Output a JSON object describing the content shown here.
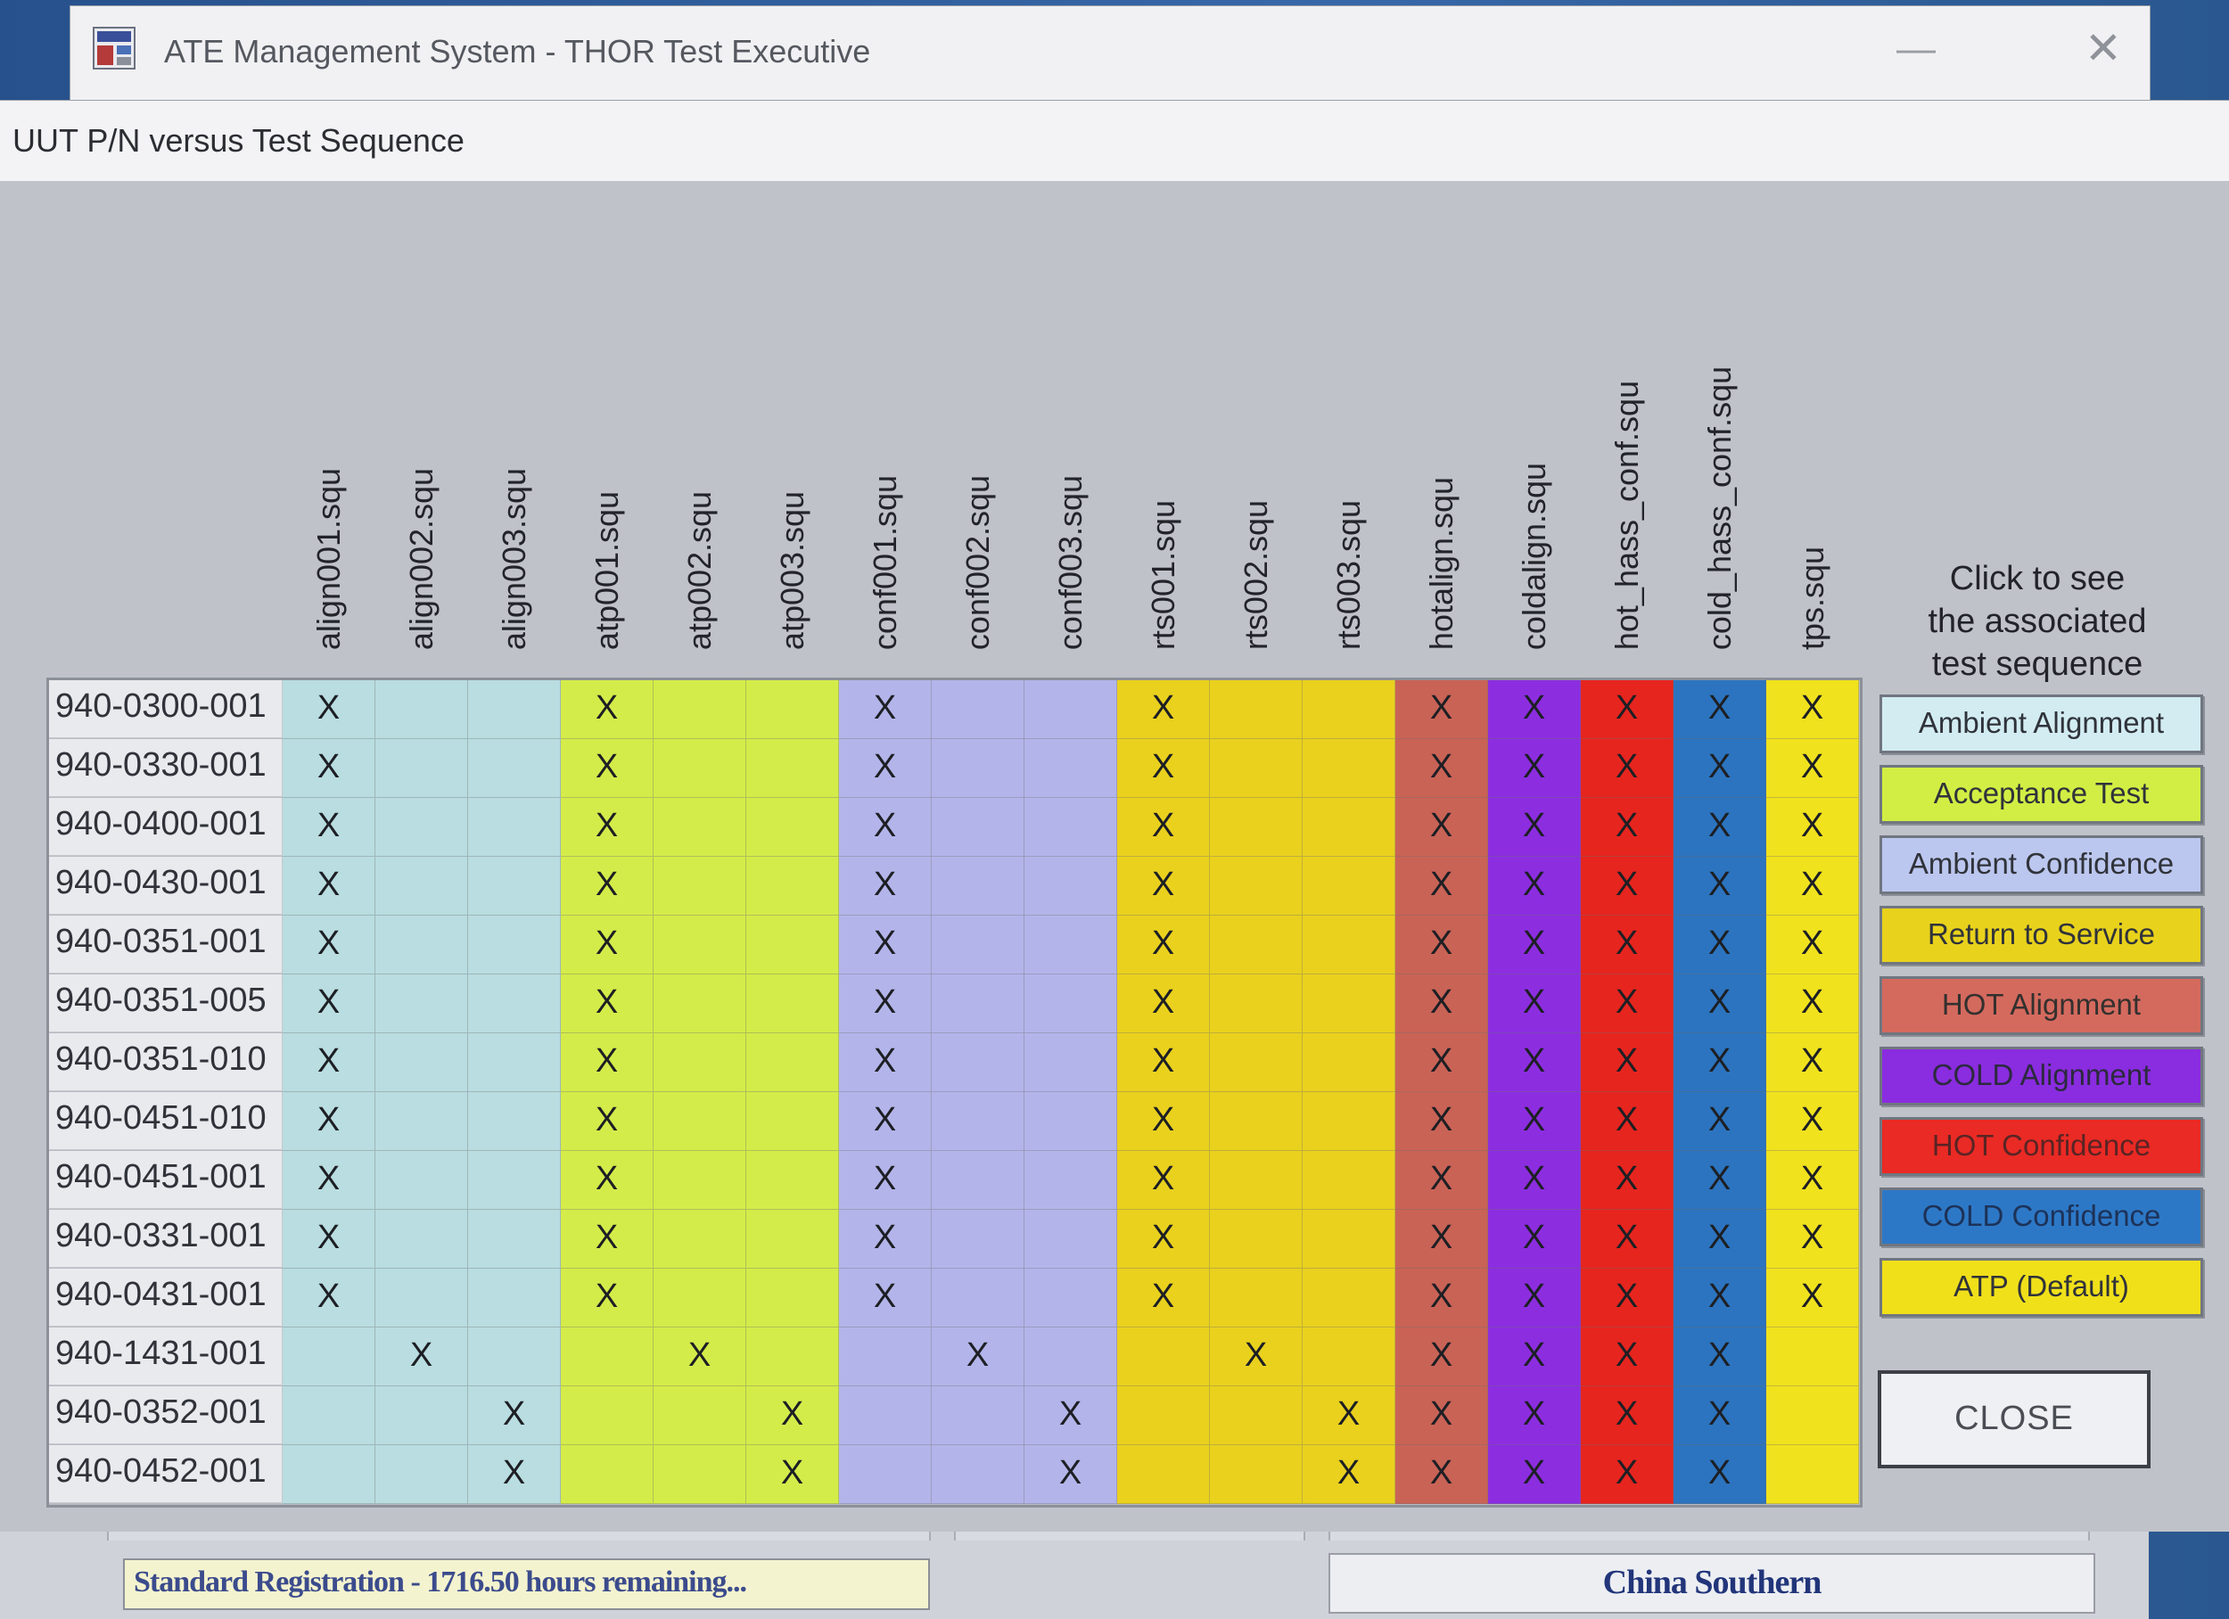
{
  "window": {
    "title": "ATE Management System - THOR Test Executive",
    "minimize_glyph": "—",
    "close_glyph": "✕"
  },
  "dialog": {
    "title": "UUT P/N versus Test Sequence",
    "columns": [
      {
        "label": "align001.squ",
        "color": "#b9dde0"
      },
      {
        "label": "align002.squ",
        "color": "#b9dde0"
      },
      {
        "label": "align003.squ",
        "color": "#b9dde0"
      },
      {
        "label": "atp001.squ",
        "color": "#d4ec4a"
      },
      {
        "label": "atp002.squ",
        "color": "#d4ec4a"
      },
      {
        "label": "atp003.squ",
        "color": "#d4ec4a"
      },
      {
        "label": "conf001.squ",
        "color": "#b3b5ea"
      },
      {
        "label": "conf002.squ",
        "color": "#b3b5ea"
      },
      {
        "label": "conf003.squ",
        "color": "#b3b5ea"
      },
      {
        "label": "rts001.squ",
        "color": "#ead11e"
      },
      {
        "label": "rts002.squ",
        "color": "#ead11e"
      },
      {
        "label": "rts003.squ",
        "color": "#ead11e"
      },
      {
        "label": "hotalign.squ",
        "color": "#c96356"
      },
      {
        "label": "coldalign.squ",
        "color": "#8c2ee0"
      },
      {
        "label": "hot_hass_conf.squ",
        "color": "#e6251f"
      },
      {
        "label": "cold_hass_conf.squ",
        "color": "#2c74bf"
      },
      {
        "label": "tps.squ",
        "color": "#f1e21e"
      }
    ],
    "rows": [
      {
        "pn": "940-0300-001",
        "marks": [
          "X",
          "",
          "",
          "X",
          "",
          "",
          "X",
          "",
          "",
          "X",
          "",
          "",
          "X",
          "X",
          "X",
          "X",
          "X"
        ]
      },
      {
        "pn": "940-0330-001",
        "marks": [
          "X",
          "",
          "",
          "X",
          "",
          "",
          "X",
          "",
          "",
          "X",
          "",
          "",
          "X",
          "X",
          "X",
          "X",
          "X"
        ]
      },
      {
        "pn": "940-0400-001",
        "marks": [
          "X",
          "",
          "",
          "X",
          "",
          "",
          "X",
          "",
          "",
          "X",
          "",
          "",
          "X",
          "X",
          "X",
          "X",
          "X"
        ]
      },
      {
        "pn": "940-0430-001",
        "marks": [
          "X",
          "",
          "",
          "X",
          "",
          "",
          "X",
          "",
          "",
          "X",
          "",
          "",
          "X",
          "X",
          "X",
          "X",
          "X"
        ]
      },
      {
        "pn": "940-0351-001",
        "marks": [
          "X",
          "",
          "",
          "X",
          "",
          "",
          "X",
          "",
          "",
          "X",
          "",
          "",
          "X",
          "X",
          "X",
          "X",
          "X"
        ]
      },
      {
        "pn": "940-0351-005",
        "marks": [
          "X",
          "",
          "",
          "X",
          "",
          "",
          "X",
          "",
          "",
          "X",
          "",
          "",
          "X",
          "X",
          "X",
          "X",
          "X"
        ]
      },
      {
        "pn": "940-0351-010",
        "marks": [
          "X",
          "",
          "",
          "X",
          "",
          "",
          "X",
          "",
          "",
          "X",
          "",
          "",
          "X",
          "X",
          "X",
          "X",
          "X"
        ]
      },
      {
        "pn": "940-0451-010",
        "marks": [
          "X",
          "",
          "",
          "X",
          "",
          "",
          "X",
          "",
          "",
          "X",
          "",
          "",
          "X",
          "X",
          "X",
          "X",
          "X"
        ]
      },
      {
        "pn": "940-0451-001",
        "marks": [
          "X",
          "",
          "",
          "X",
          "",
          "",
          "X",
          "",
          "",
          "X",
          "",
          "",
          "X",
          "X",
          "X",
          "X",
          "X"
        ]
      },
      {
        "pn": "940-0331-001",
        "marks": [
          "X",
          "",
          "",
          "X",
          "",
          "",
          "X",
          "",
          "",
          "X",
          "",
          "",
          "X",
          "X",
          "X",
          "X",
          "X"
        ]
      },
      {
        "pn": "940-0431-001",
        "marks": [
          "X",
          "",
          "",
          "X",
          "",
          "",
          "X",
          "",
          "",
          "X",
          "",
          "",
          "X",
          "X",
          "X",
          "X",
          "X"
        ]
      },
      {
        "pn": "940-1431-001",
        "marks": [
          "",
          "X",
          "",
          "",
          "X",
          "",
          "",
          "X",
          "",
          "",
          "X",
          "",
          "X",
          "X",
          "X",
          "X",
          ""
        ]
      },
      {
        "pn": "940-0352-001",
        "marks": [
          "",
          "",
          "X",
          "",
          "",
          "X",
          "",
          "",
          "X",
          "",
          "",
          "X",
          "X",
          "X",
          "X",
          "X",
          ""
        ]
      },
      {
        "pn": "940-0452-001",
        "marks": [
          "",
          "",
          "X",
          "",
          "",
          "X",
          "",
          "",
          "X",
          "",
          "",
          "X",
          "X",
          "X",
          "X",
          "X",
          ""
        ]
      }
    ],
    "legend": {
      "caption_lines": [
        "Click to see",
        "the associated",
        "test sequence"
      ],
      "buttons": [
        {
          "label": "Ambient Alignment",
          "color": "#d2ecf2",
          "text_color": "#30333a"
        },
        {
          "label": "Acceptance Test",
          "color": "#d2ee44",
          "text_color": "#30333a"
        },
        {
          "label": "Ambient Confidence",
          "color": "#bcc7ef",
          "text_color": "#30333a"
        },
        {
          "label": "Return to Service",
          "color": "#e8d21c",
          "text_color": "#30333a"
        },
        {
          "label": "HOT Alignment",
          "color": "#d46a5e",
          "text_color": "#33302e"
        },
        {
          "label": "COLD Alignment",
          "color": "#8a2ce0",
          "text_color": "#2c2a3e"
        },
        {
          "label": "HOT Confidence",
          "color": "#ea2a24",
          "text_color": "#5a2424"
        },
        {
          "label": "COLD Confidence",
          "color": "#2d78c6",
          "text_color": "#1d3258"
        },
        {
          "label": "ATP (Default)",
          "color": "#f0e01a",
          "text_color": "#30333a"
        }
      ],
      "close_label": "CLOSE"
    }
  },
  "status_bar": {
    "registration": "Standard Registration - 1716.50 hours remaining...",
    "customer": "China Southern"
  }
}
